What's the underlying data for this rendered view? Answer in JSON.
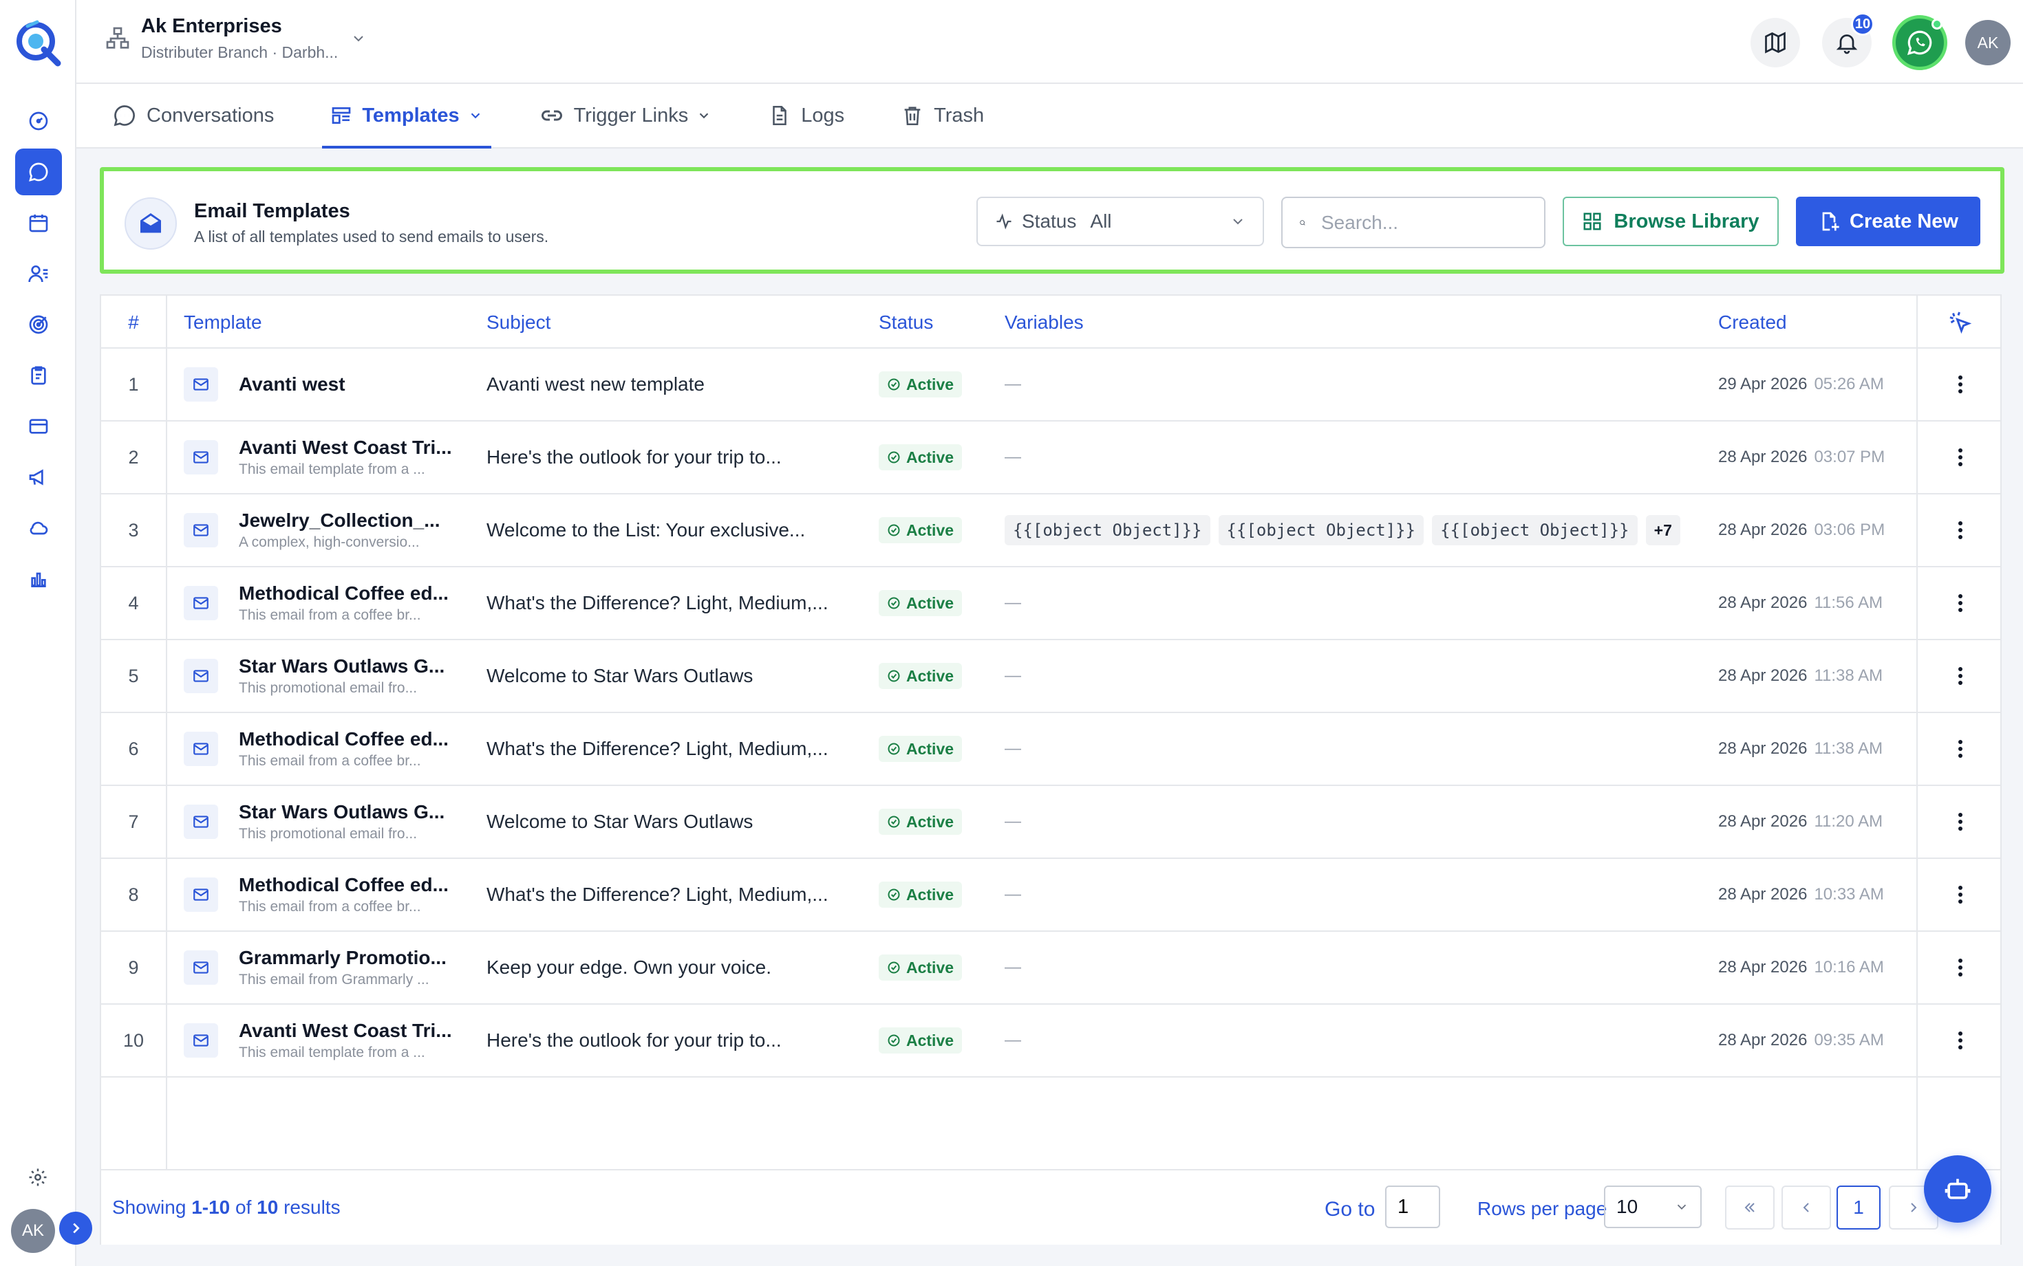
{
  "org": {
    "name": "Ak Enterprises",
    "sub": "Distributer Branch · Darbh..."
  },
  "header": {
    "notification_count": "10",
    "avatar_initials": "AK"
  },
  "sidebar": {
    "items": [
      {
        "icon": "dashboard-gauge-icon",
        "active": false
      },
      {
        "icon": "chat-bubble-icon",
        "active": true
      },
      {
        "icon": "calendar-icon",
        "active": false
      },
      {
        "icon": "contacts-icon",
        "active": false
      },
      {
        "icon": "target-icon",
        "active": false
      },
      {
        "icon": "clipboard-icon",
        "active": false
      },
      {
        "icon": "card-icon",
        "active": false
      },
      {
        "icon": "megaphone-icon",
        "active": false
      },
      {
        "icon": "cloud-icon",
        "active": false
      },
      {
        "icon": "bar-chart-icon",
        "active": false
      }
    ],
    "avatar_initials": "AK"
  },
  "tabs": [
    {
      "label": "Conversations",
      "icon": "chat-dots-icon",
      "active": false,
      "dropdown": false
    },
    {
      "label": "Templates",
      "icon": "templates-icon",
      "active": true,
      "dropdown": true
    },
    {
      "label": "Trigger Links",
      "icon": "link-icon",
      "active": false,
      "dropdown": true
    },
    {
      "label": "Logs",
      "icon": "document-icon",
      "active": false,
      "dropdown": false
    },
    {
      "label": "Trash",
      "icon": "trash-icon",
      "active": false,
      "dropdown": false
    }
  ],
  "card": {
    "title": "Email Templates",
    "subtitle": "A list of all templates used to send emails to users.",
    "status_label": "Status",
    "status_value": "All",
    "search_placeholder": "Search...",
    "browse_label": "Browse Library",
    "create_label": "Create New"
  },
  "table": {
    "headers": {
      "num": "#",
      "template": "Template",
      "subject": "Subject",
      "status": "Status",
      "variables": "Variables",
      "created": "Created"
    },
    "rows": [
      {
        "num": "1",
        "name": "Avanti west",
        "desc": "",
        "subject": "Avanti west new template",
        "status": "Active",
        "variables": [],
        "more": "",
        "date": "29 Apr 2026",
        "time": "05:26 AM"
      },
      {
        "num": "2",
        "name": "Avanti West Coast Tri...",
        "desc": "This email template from a ...",
        "subject": "Here's the outlook for your trip to...",
        "status": "Active",
        "variables": [],
        "more": "",
        "date": "28 Apr 2026",
        "time": "03:07 PM"
      },
      {
        "num": "3",
        "name": "Jewelry_Collection_...",
        "desc": "A complex, high-conversio...",
        "subject": "Welcome to the List: Your exclusive...",
        "status": "Active",
        "variables": [
          "{{[object Object]}}",
          "{{[object Object]}}",
          "{{[object Object]}}"
        ],
        "more": "+7",
        "date": "28 Apr 2026",
        "time": "03:06 PM"
      },
      {
        "num": "4",
        "name": "Methodical Coffee ed...",
        "desc": "This email from a coffee br...",
        "subject": "What's the Difference? Light, Medium,...",
        "status": "Active",
        "variables": [],
        "more": "",
        "date": "28 Apr 2026",
        "time": "11:56 AM"
      },
      {
        "num": "5",
        "name": "Star Wars Outlaws G...",
        "desc": "This promotional email fro...",
        "subject": "Welcome to Star Wars Outlaws",
        "status": "Active",
        "variables": [],
        "more": "",
        "date": "28 Apr 2026",
        "time": "11:38 AM"
      },
      {
        "num": "6",
        "name": "Methodical Coffee ed...",
        "desc": "This email from a coffee br...",
        "subject": "What's the Difference? Light, Medium,...",
        "status": "Active",
        "variables": [],
        "more": "",
        "date": "28 Apr 2026",
        "time": "11:38 AM"
      },
      {
        "num": "7",
        "name": "Star Wars Outlaws G...",
        "desc": "This promotional email fro...",
        "subject": "Welcome to Star Wars Outlaws",
        "status": "Active",
        "variables": [],
        "more": "",
        "date": "28 Apr 2026",
        "time": "11:20 AM"
      },
      {
        "num": "8",
        "name": "Methodical Coffee ed...",
        "desc": "This email from a coffee br...",
        "subject": "What's the Difference? Light, Medium,...",
        "status": "Active",
        "variables": [],
        "more": "",
        "date": "28 Apr 2026",
        "time": "10:33 AM"
      },
      {
        "num": "9",
        "name": "Grammarly Promotio...",
        "desc": "This email from Grammarly ...",
        "subject": "Keep your edge. Own your voice.",
        "status": "Active",
        "variables": [],
        "more": "",
        "date": "28 Apr 2026",
        "time": "10:16 AM"
      },
      {
        "num": "10",
        "name": "Avanti West Coast Tri...",
        "desc": "This email template from a ...",
        "subject": "Here's the outlook for your trip to...",
        "status": "Active",
        "variables": [],
        "more": "",
        "date": "28 Apr 2026",
        "time": "09:35 AM"
      }
    ],
    "empty_dash": "—"
  },
  "footer": {
    "showing_prefix": "Showing",
    "range": "1-10",
    "of": "of",
    "total": "10",
    "results": "results",
    "goto_label": "Go to",
    "goto_value": "1",
    "rows_per_page_label": "Rows per page",
    "rows_per_page_value": "10",
    "current_page": "1"
  },
  "colors": {
    "accent": "#2d5be3",
    "highlight_border": "#7ee55a",
    "status_green": "#1b7f45",
    "whatsapp": "#1f9d4f"
  }
}
